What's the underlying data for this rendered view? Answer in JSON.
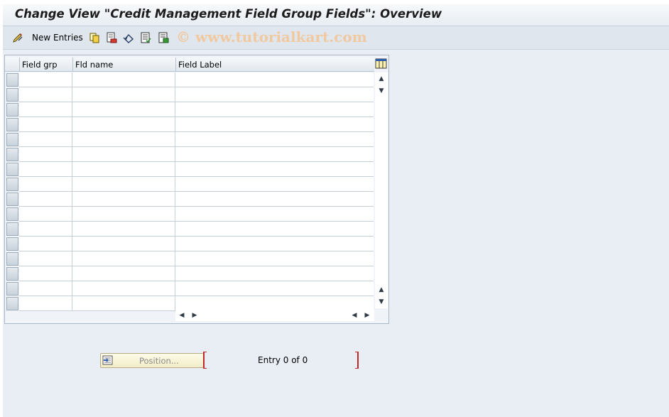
{
  "window": {
    "title": "Change View \"Credit Management Field Group Fields\": Overview"
  },
  "toolbar": {
    "new_entries_label": "New Entries",
    "watermark": "© www.tutorialkart.com",
    "icons": [
      "edit-display-icon",
      "copy-icon",
      "delete-icon",
      "undo-icon",
      "select-all-icon",
      "deselect-all-icon"
    ]
  },
  "table": {
    "columns": [
      "Field grp",
      "Fld name",
      "Field Label"
    ],
    "rows": []
  },
  "footer": {
    "position_button_label": "Position...",
    "entry_text": "Entry 0 of 0"
  },
  "colors": {
    "background": "#e9eef4",
    "toolbar": "#dfe6ee",
    "button": "#f2edc6",
    "bracket": "#c0282a"
  }
}
